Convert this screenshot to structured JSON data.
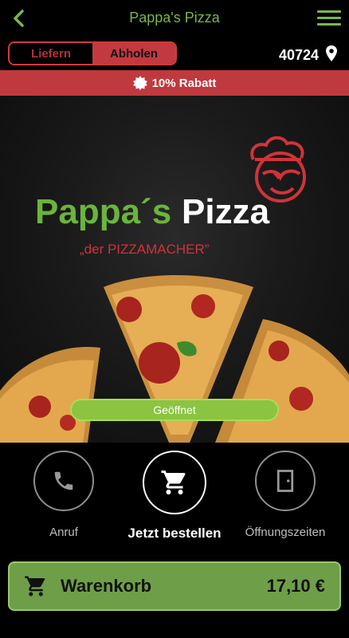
{
  "header": {
    "title": "Pappa's Pizza"
  },
  "mode": {
    "deliver_label": "Liefern",
    "pickup_label": "Abholen",
    "postal_code": "40724"
  },
  "promo": {
    "text": "10% Rabatt"
  },
  "hero": {
    "brand_name_part1": "Pappa´s",
    "brand_name_part2": "Pizza",
    "slogan": "„der PIZZAMACHER”",
    "status": "Geöffnet"
  },
  "actions": {
    "call_label": "Anruf",
    "order_label": "Jetzt bestellen",
    "hours_label": "Öffnungszeiten"
  },
  "cart": {
    "label": "Warenkorb",
    "total": "17,10 €"
  },
  "colors": {
    "brand_green": "#7ab648",
    "accent_red": "#c0393f",
    "cart_green": "#6e9f48"
  }
}
